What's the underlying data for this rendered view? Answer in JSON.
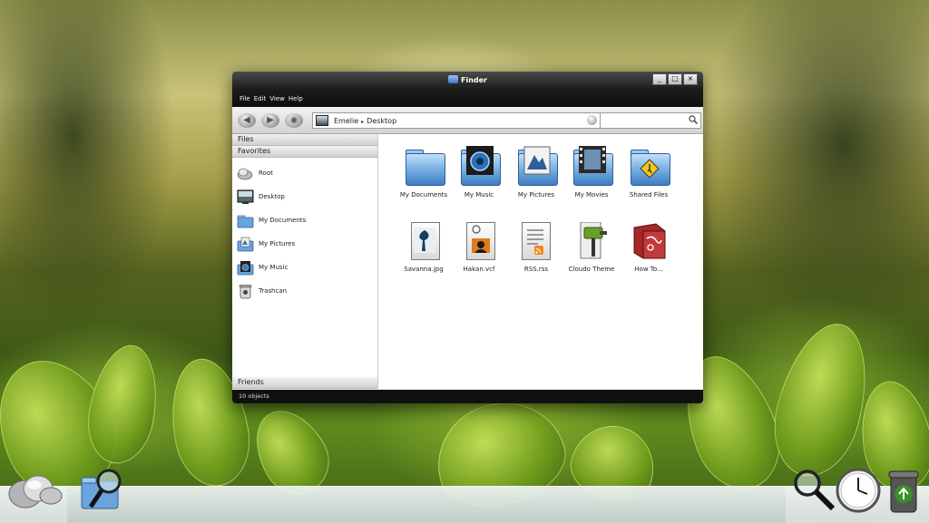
{
  "window": {
    "title": "Finder",
    "buttons": {
      "minimize": "_",
      "maximize": "□",
      "close": "×"
    }
  },
  "menu": [
    "File",
    "Edit",
    "View",
    "Help"
  ],
  "toolbar": {
    "back_icon": "back-arrow-icon",
    "forward_icon": "forward-arrow-icon",
    "view_icon": "eye-icon",
    "breadcrumb": [
      "Emelie",
      "Desktop"
    ],
    "breadcrumb_separator": "▸",
    "search_placeholder": ""
  },
  "sidebar": {
    "files_header": "Files",
    "favorites_header": "Favorites",
    "items": [
      {
        "label": "Root",
        "icon": "cloud-icon"
      },
      {
        "label": "Desktop",
        "icon": "desktop-icon"
      },
      {
        "label": "My Documents",
        "icon": "folder-icon"
      },
      {
        "label": "My Pictures",
        "icon": "pictures-folder-icon"
      },
      {
        "label": "My Music",
        "icon": "music-folder-icon"
      },
      {
        "label": "Trashcan",
        "icon": "trashcan-icon"
      }
    ],
    "friends_header": "Friends"
  },
  "files": [
    {
      "label": "My Documents",
      "icon": "folder-icon"
    },
    {
      "label": "My Music",
      "icon": "music-folder-icon"
    },
    {
      "label": "My Pictures",
      "icon": "pictures-folder-icon"
    },
    {
      "label": "My Movies",
      "icon": "movies-folder-icon"
    },
    {
      "label": "Shared Files",
      "icon": "shared-folder-icon"
    },
    {
      "label": "Savanna.jpg",
      "icon": "image-file-icon"
    },
    {
      "label": "Hakan.vcf",
      "icon": "vcard-file-icon"
    },
    {
      "label": "RSS.rss",
      "icon": "rss-file-icon"
    },
    {
      "label": "Cloudo Theme",
      "icon": "theme-paint-icon"
    },
    {
      "label": "How To...",
      "icon": "book-icon"
    }
  ],
  "status": {
    "text": "10 objects"
  },
  "taskbar": {
    "left": [
      "cloud-logo-icon",
      "finder-folder-search-icon"
    ],
    "right": [
      "search-magnifier-icon",
      "clock-icon",
      "recycle-bin-icon"
    ]
  },
  "colors": {
    "accent": "#3f7cc2",
    "titlebar": "#1a1a1a"
  }
}
